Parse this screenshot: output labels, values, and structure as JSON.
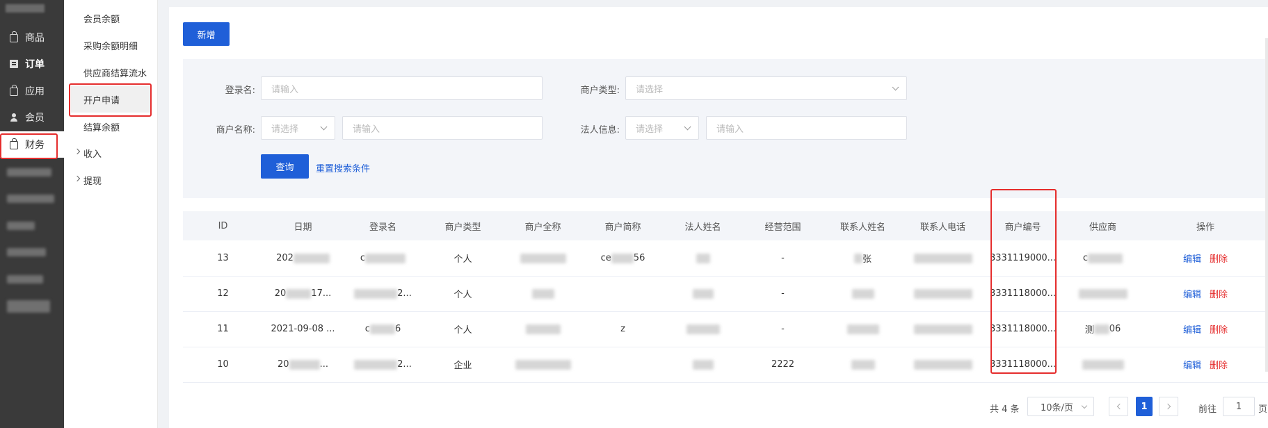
{
  "sidebar": {
    "items": [
      {
        "label": "商品",
        "icon": "bag-icon"
      },
      {
        "label": "订单",
        "icon": "document-icon"
      },
      {
        "label": "应用",
        "icon": "bag-icon"
      },
      {
        "label": "会员",
        "icon": "user-icon"
      },
      {
        "label": "财务",
        "icon": "bag-icon"
      }
    ]
  },
  "submenu": {
    "items": [
      {
        "label": "会员余额"
      },
      {
        "label": "采购余额明细"
      },
      {
        "label": "供应商结算流水"
      },
      {
        "label": "开户申请"
      },
      {
        "label": "结算余额"
      },
      {
        "label": "收入"
      },
      {
        "label": "提现"
      }
    ]
  },
  "toolbar": {
    "add_label": "新增"
  },
  "filters": {
    "login_label": "登录名:",
    "login_placeholder": "请输入",
    "type_label": "商户类型:",
    "type_placeholder": "请选择",
    "name_label": "商户名称:",
    "name_select_placeholder": "请选择",
    "name_input_placeholder": "请输入",
    "legal_label": "法人信息:",
    "legal_select_placeholder": "请选择",
    "legal_input_placeholder": "请输入",
    "query_label": "查询",
    "reset_label": "重置搜索条件"
  },
  "table": {
    "headers": [
      "ID",
      "日期",
      "登录名",
      "商户类型",
      "商户全称",
      "商户简称",
      "法人姓名",
      "经营范围",
      "联系人姓名",
      "联系人电话",
      "商户编号",
      "供应商",
      "操作"
    ],
    "rows": [
      {
        "id": "13",
        "date": "202",
        "login": "c",
        "type": "个人",
        "full": "",
        "short": "ce",
        "short2": "56",
        "legal": "",
        "scope": "-",
        "contact": "张",
        "phone": "",
        "code": "3331119000...",
        "supplier": "c"
      },
      {
        "id": "12",
        "date": "20",
        "date2": "17...",
        "login": "",
        "login2": "2...",
        "type": "个人",
        "full": "",
        "short": "",
        "short2": "",
        "legal": "",
        "scope": "-",
        "contact": "",
        "phone": "",
        "code": "3331118000...",
        "supplier": ""
      },
      {
        "id": "11",
        "date": "2021-09-08 ...",
        "login": "c",
        "login2": "6",
        "type": "个人",
        "full": "",
        "short": "z",
        "short2": "",
        "legal": "",
        "scope": "-",
        "contact": "",
        "phone": "",
        "code": "3331118000...",
        "supplier": "测",
        "supplier2": "06"
      },
      {
        "id": "10",
        "date": "20",
        "date2": "...",
        "login": "",
        "login2": "2...",
        "type": "企业",
        "full": "",
        "short": "",
        "short2": "",
        "legal": "",
        "scope": "2222",
        "contact": "",
        "phone": "",
        "code": "3331118000...",
        "supplier": ""
      }
    ],
    "edit_label": "编辑",
    "delete_label": "删除"
  },
  "pagination": {
    "total": "共 4 条",
    "page_size": "10条/页",
    "current": "1",
    "goto_label": "前往",
    "goto_value": "1",
    "goto_suffix": "页"
  },
  "colors": {
    "primary": "#1f5fd8",
    "danger": "#e52d2d",
    "sidebar_bg": "#3a3a3a"
  }
}
